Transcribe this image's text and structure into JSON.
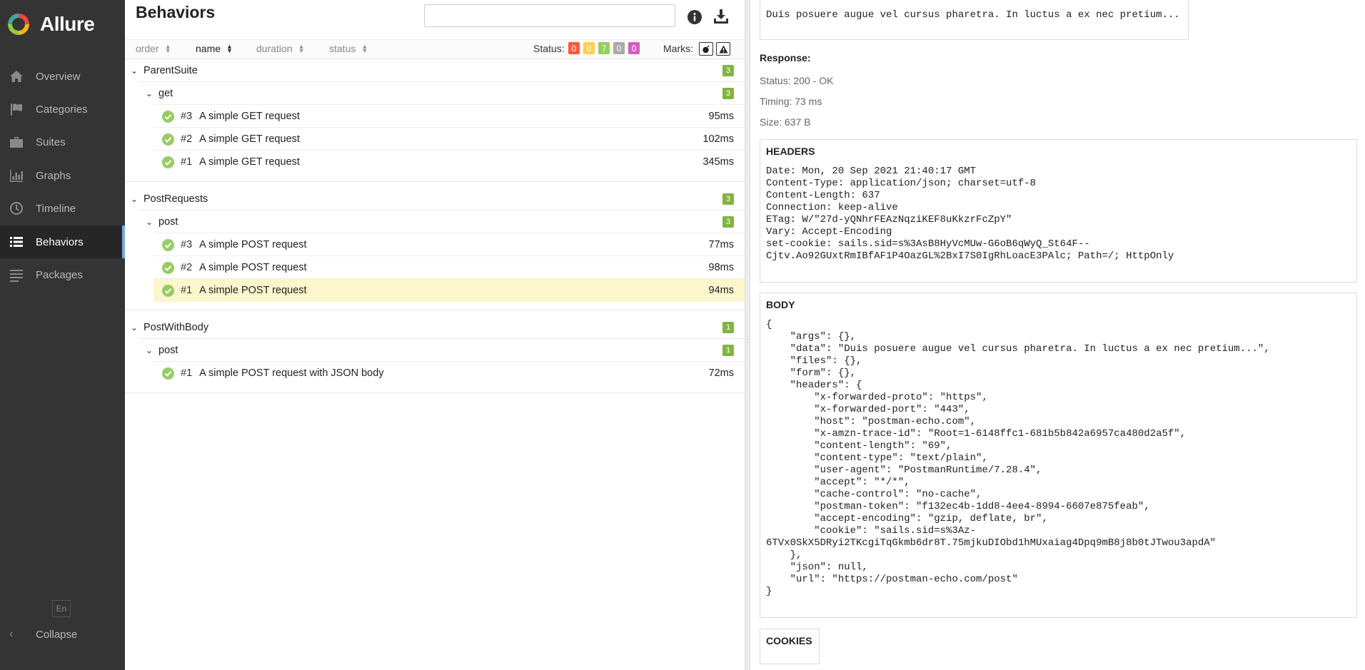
{
  "app": {
    "name": "Allure"
  },
  "sidebar": {
    "items": [
      {
        "label": "Overview",
        "icon": "home-icon"
      },
      {
        "label": "Categories",
        "icon": "flag-icon"
      },
      {
        "label": "Suites",
        "icon": "briefcase-icon"
      },
      {
        "label": "Graphs",
        "icon": "bar-chart-icon"
      },
      {
        "label": "Timeline",
        "icon": "clock-icon"
      },
      {
        "label": "Behaviors",
        "icon": "list-icon",
        "active": true
      },
      {
        "label": "Packages",
        "icon": "packages-icon"
      }
    ],
    "language": "En",
    "collapse_label": "Collapse"
  },
  "main": {
    "title": "Behaviors",
    "search": {
      "value": "",
      "placeholder": ""
    },
    "sorters": [
      {
        "label": "order"
      },
      {
        "label": "name",
        "active": true
      },
      {
        "label": "duration"
      },
      {
        "label": "status"
      }
    ],
    "status_label": "Status:",
    "status_counts": [
      {
        "value": "0",
        "color": "#fd5a3e"
      },
      {
        "value": "0",
        "color": "#ffd050"
      },
      {
        "value": "7",
        "color": "#97cc64"
      },
      {
        "value": "0",
        "color": "#aaaaaa"
      },
      {
        "value": "0",
        "color": "#d35ebe"
      }
    ],
    "marks_label": "Marks:",
    "groups": [
      {
        "name": "ParentSuite",
        "count": "3",
        "children": [
          {
            "name": "get",
            "count": "3",
            "tests": [
              {
                "order": "#3",
                "name": "A simple GET request",
                "duration": "95ms"
              },
              {
                "order": "#2",
                "name": "A simple GET request",
                "duration": "102ms"
              },
              {
                "order": "#1",
                "name": "A simple GET request",
                "duration": "345ms"
              }
            ]
          }
        ]
      },
      {
        "name": "PostRequests",
        "count": "3",
        "children": [
          {
            "name": "post",
            "count": "3",
            "tests": [
              {
                "order": "#3",
                "name": "A simple POST request",
                "duration": "77ms"
              },
              {
                "order": "#2",
                "name": "A simple POST request",
                "duration": "98ms"
              },
              {
                "order": "#1",
                "name": "A simple POST request",
                "duration": "94ms",
                "selected": true
              }
            ]
          }
        ]
      },
      {
        "name": "PostWithBody",
        "count": "1",
        "children": [
          {
            "name": "post",
            "count": "1",
            "tests": [
              {
                "order": "#1",
                "name": "A simple POST request with JSON body",
                "duration": "72ms"
              }
            ]
          }
        ]
      }
    ]
  },
  "details": {
    "request_body": "Duis posuere augue vel cursus pharetra. In luctus a ex nec pretium...",
    "response_title": "Response:",
    "status": "Status: 200 - OK",
    "timing": "Timing: 73 ms",
    "size": "Size: 637 B",
    "headers_title": "HEADERS",
    "headers_text": "Date: Mon, 20 Sep 2021 21:40:17 GMT\nContent-Type: application/json; charset=utf-8\nContent-Length: 637\nConnection: keep-alive\nETag: W/\"27d-yQNhrFEAzNqziKEF8uKkzrFcZpY\"\nVary: Accept-Encoding\nset-cookie: sails.sid=s%3AsB8HyVcMUw-G6oB6qWyQ_St64F--\nCjtv.Ao92GUxtRmIBfAF1P4OazGL%2BxI7S0IgRhLoacE3PAlc; Path=/; HttpOnly",
    "body_title": "BODY",
    "body_text": "{\n    \"args\": {},\n    \"data\": \"Duis posuere augue vel cursus pharetra. In luctus a ex nec pretium...\",\n    \"files\": {},\n    \"form\": {},\n    \"headers\": {\n        \"x-forwarded-proto\": \"https\",\n        \"x-forwarded-port\": \"443\",\n        \"host\": \"postman-echo.com\",\n        \"x-amzn-trace-id\": \"Root=1-6148ffc1-681b5b842a6957ca480d2a5f\",\n        \"content-length\": \"69\",\n        \"content-type\": \"text/plain\",\n        \"user-agent\": \"PostmanRuntime/7.28.4\",\n        \"accept\": \"*/*\",\n        \"cache-control\": \"no-cache\",\n        \"postman-token\": \"f132ec4b-1dd8-4ee4-8994-6607e875feab\",\n        \"accept-encoding\": \"gzip, deflate, br\",\n        \"cookie\": \"sails.sid=s%3Az-\n6TVx0SkX5DRyi2TKcgiTqGkmb6dr8T.75mjkuDIObd1hMUxaiag4Dpq9mB8j8b0tJTwou3apdA\"\n    },\n    \"json\": null,\n    \"url\": \"https://postman-echo.com/post\"\n}",
    "cookies_title": "COOKIES"
  }
}
